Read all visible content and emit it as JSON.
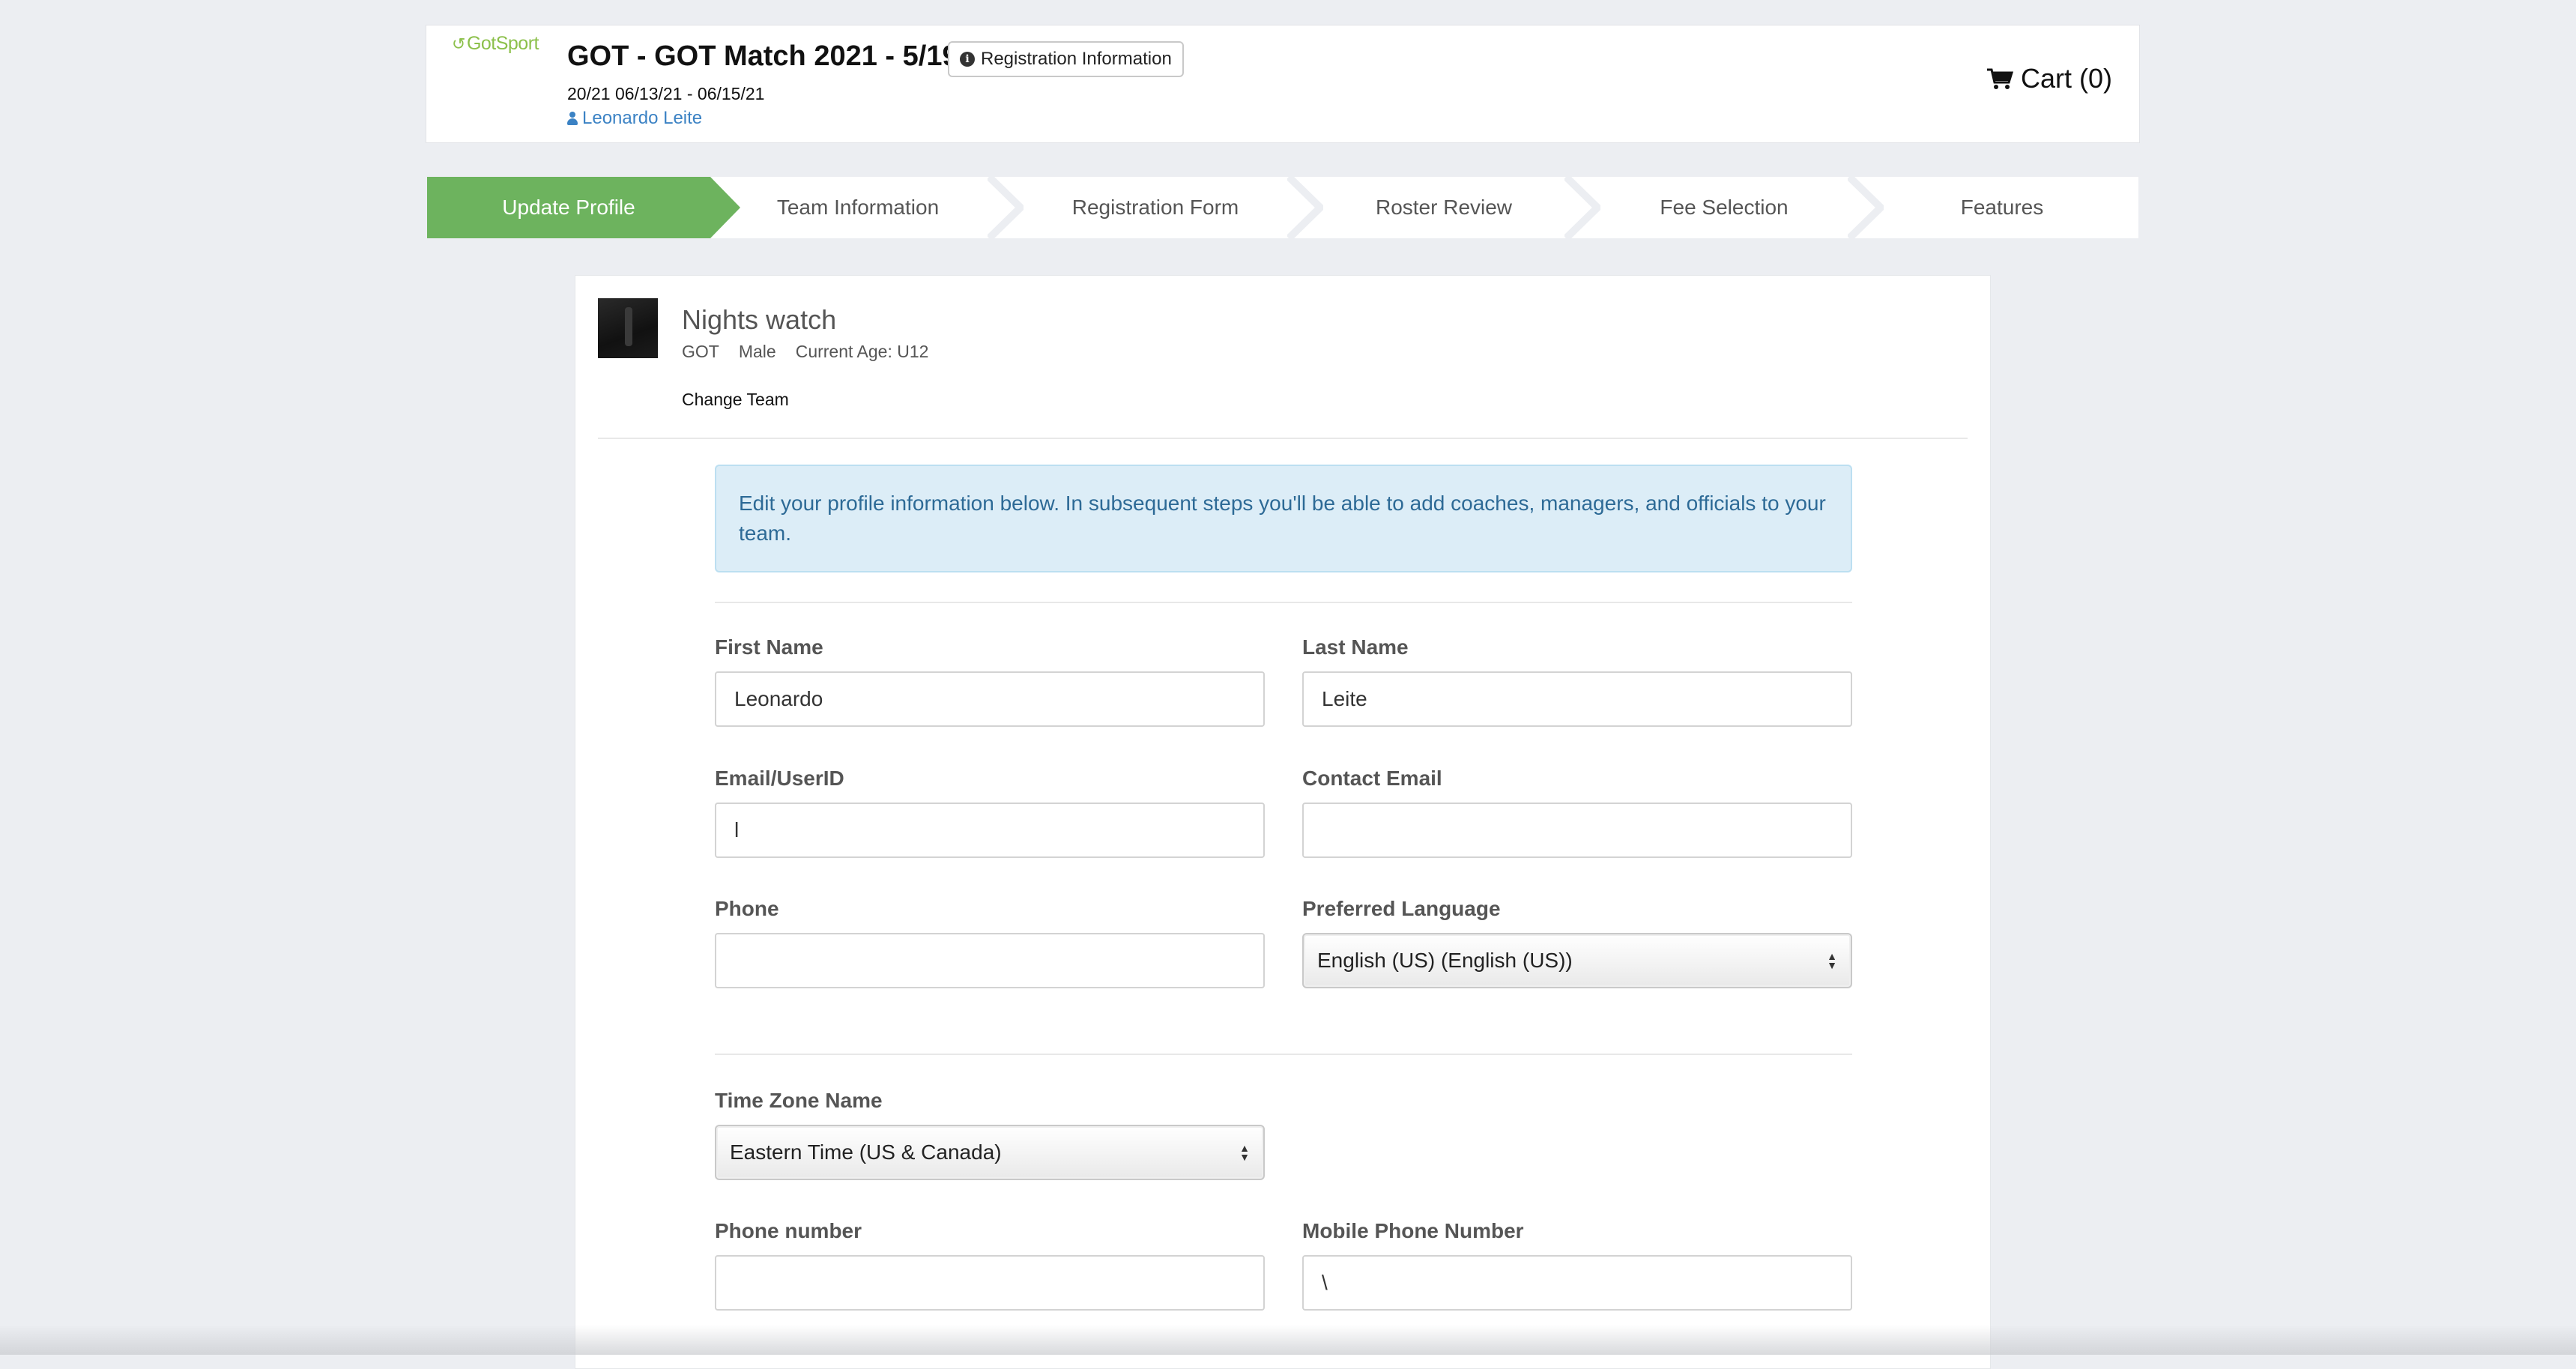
{
  "header": {
    "logo_text": "GotSport",
    "event_title": "GOT - GOT Match 2021 - 5/19",
    "registration_info_label": "Registration Information",
    "event_dates": "20/21 06/13/21 - 06/15/21",
    "user_name": "Leonardo Leite",
    "cart_label": "Cart (0)"
  },
  "steps": [
    {
      "label": "Update Profile",
      "active": true
    },
    {
      "label": "Team Information",
      "active": false
    },
    {
      "label": "Registration Form",
      "active": false
    },
    {
      "label": "Roster Review",
      "active": false
    },
    {
      "label": "Fee Selection",
      "active": false
    },
    {
      "label": "Features",
      "active": false
    }
  ],
  "team": {
    "name": "Nights watch",
    "club": "GOT",
    "gender": "Male",
    "age": "Current Age: U12",
    "change_label": "Change Team"
  },
  "alert_text": "Edit your profile information below. In subsequent steps you'll be able to add coaches, managers, and officials to your team.",
  "form": {
    "first_name": {
      "label": "First Name",
      "value": "Leonardo"
    },
    "last_name": {
      "label": "Last Name",
      "value": "Leite"
    },
    "email": {
      "label": "Email/UserID",
      "value": "l"
    },
    "contact_email": {
      "label": "Contact Email",
      "value": ""
    },
    "phone": {
      "label": "Phone",
      "value": ""
    },
    "language": {
      "label": "Preferred Language",
      "value": "English (US) (English (US))"
    },
    "timezone": {
      "label": "Time Zone Name",
      "value": "Eastern Time (US & Canada)"
    },
    "phone_number": {
      "label": "Phone number",
      "value": ""
    },
    "mobile_phone": {
      "label": "Mobile Phone Number",
      "value": "\\"
    }
  },
  "colors": {
    "accent_green": "#6db35e",
    "link_blue": "#3b82c4",
    "alert_bg": "#dcedf7",
    "page_bg": "#eceef2"
  }
}
